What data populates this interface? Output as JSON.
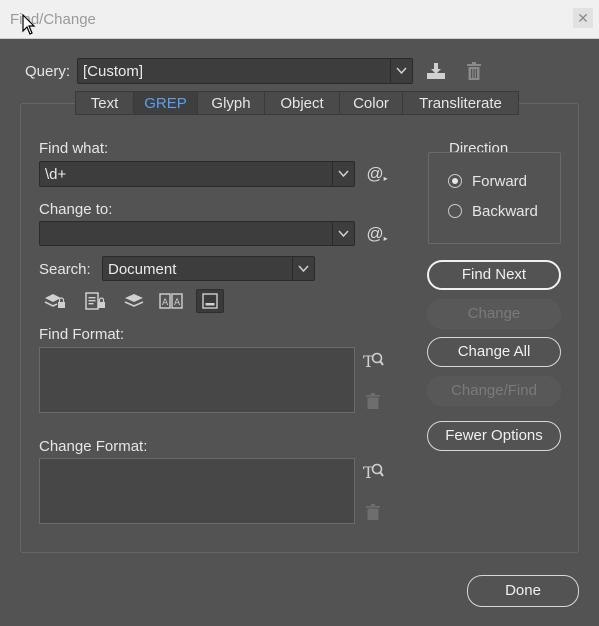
{
  "window": {
    "title": "Find/Change",
    "close_icon": "close-icon"
  },
  "query": {
    "label": "Query:",
    "value": "[Custom]"
  },
  "tabs": [
    {
      "label": "Text"
    },
    {
      "label": "GREP"
    },
    {
      "label": "Glyph"
    },
    {
      "label": "Object"
    },
    {
      "label": "Color"
    },
    {
      "label": "Transliterate"
    }
  ],
  "find_what": {
    "label": "Find what:",
    "value": "\\d+"
  },
  "change_to": {
    "label": "Change to:",
    "value": ""
  },
  "search": {
    "label": "Search:",
    "value": "Document"
  },
  "find_format": {
    "label": "Find Format:"
  },
  "change_format": {
    "label": "Change Format:"
  },
  "direction": {
    "label": "Direction",
    "forward": "Forward",
    "backward": "Backward",
    "selected": "Forward"
  },
  "buttons": {
    "find_next": "Find Next",
    "change": "Change",
    "change_all": "Change All",
    "change_find": "Change/Find",
    "fewer_options": "Fewer Options",
    "done": "Done"
  },
  "colors": {
    "accent": "#5aa0f0",
    "bg": "#535353",
    "field": "#3d3d3d"
  }
}
